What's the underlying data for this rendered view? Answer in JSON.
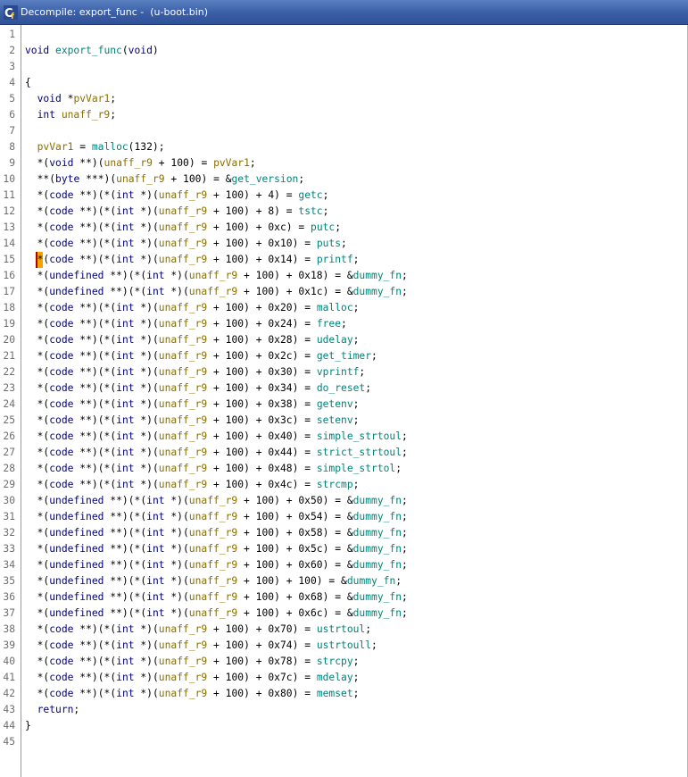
{
  "window": {
    "title": "Decompile: export_func -  (u-boot.bin)"
  },
  "icons": {
    "app_icon": "ghidra-decompiler-icon"
  },
  "editor": {
    "cursor_line": 15,
    "lines": [
      "",
      "void export_func(void)",
      "",
      "{",
      "  void *pvVar1;",
      "  int unaff_r9;",
      "  ",
      "  pvVar1 = malloc(132);",
      "  *(void **)(unaff_r9 + 100) = pvVar1;",
      "  **(byte ***)(unaff_r9 + 100) = &get_version;",
      "  *(code **)(*(int *)(unaff_r9 + 100) + 4) = getc;",
      "  *(code **)(*(int *)(unaff_r9 + 100) + 8) = tstc;",
      "  *(code **)(*(int *)(unaff_r9 + 100) + 0xc) = putc;",
      "  *(code **)(*(int *)(unaff_r9 + 100) + 0x10) = puts;",
      "  *(code **)(*(int *)(unaff_r9 + 100) + 0x14) = printf;",
      "  *(undefined **)(*(int *)(unaff_r9 + 100) + 0x18) = &dummy_fn;",
      "  *(undefined **)(*(int *)(unaff_r9 + 100) + 0x1c) = &dummy_fn;",
      "  *(code **)(*(int *)(unaff_r9 + 100) + 0x20) = malloc;",
      "  *(code **)(*(int *)(unaff_r9 + 100) + 0x24) = free;",
      "  *(code **)(*(int *)(unaff_r9 + 100) + 0x28) = udelay;",
      "  *(code **)(*(int *)(unaff_r9 + 100) + 0x2c) = get_timer;",
      "  *(code **)(*(int *)(unaff_r9 + 100) + 0x30) = vprintf;",
      "  *(code **)(*(int *)(unaff_r9 + 100) + 0x34) = do_reset;",
      "  *(code **)(*(int *)(unaff_r9 + 100) + 0x38) = getenv;",
      "  *(code **)(*(int *)(unaff_r9 + 100) + 0x3c) = setenv;",
      "  *(code **)(*(int *)(unaff_r9 + 100) + 0x40) = simple_strtoul;",
      "  *(code **)(*(int *)(unaff_r9 + 100) + 0x44) = strict_strtoul;",
      "  *(code **)(*(int *)(unaff_r9 + 100) + 0x48) = simple_strtol;",
      "  *(code **)(*(int *)(unaff_r9 + 100) + 0x4c) = strcmp;",
      "  *(undefined **)(*(int *)(unaff_r9 + 100) + 0x50) = &dummy_fn;",
      "  *(undefined **)(*(int *)(unaff_r9 + 100) + 0x54) = &dummy_fn;",
      "  *(undefined **)(*(int *)(unaff_r9 + 100) + 0x58) = &dummy_fn;",
      "  *(undefined **)(*(int *)(unaff_r9 + 100) + 0x5c) = &dummy_fn;",
      "  *(undefined **)(*(int *)(unaff_r9 + 100) + 0x60) = &dummy_fn;",
      "  *(undefined **)(*(int *)(unaff_r9 + 100) + 100) = &dummy_fn;",
      "  *(undefined **)(*(int *)(unaff_r9 + 100) + 0x68) = &dummy_fn;",
      "  *(undefined **)(*(int *)(unaff_r9 + 100) + 0x6c) = &dummy_fn;",
      "  *(code **)(*(int *)(unaff_r9 + 100) + 0x70) = ustrtoul;",
      "  *(code **)(*(int *)(unaff_r9 + 100) + 0x74) = ustrtoull;",
      "  *(code **)(*(int *)(unaff_r9 + 100) + 0x78) = strcpy;",
      "  *(code **)(*(int *)(unaff_r9 + 100) + 0x7c) = mdelay;",
      "  *(code **)(*(int *)(unaff_r9 + 100) + 0x80) = memset;",
      "  return;",
      "}",
      ""
    ]
  },
  "colors": {
    "keyword": "#00007a",
    "variable": "#8a6f00",
    "function": "#00837a",
    "cursor": "#f4a400"
  }
}
